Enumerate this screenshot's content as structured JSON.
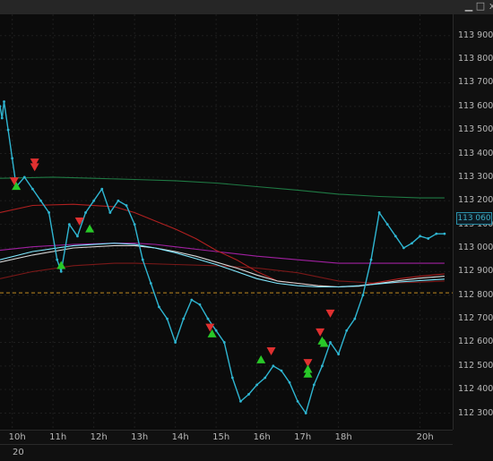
{
  "window": {
    "minimize_label": "▁",
    "restore_label": "□",
    "close_label": "x"
  },
  "current_price_label": "113 060",
  "date_label": "20",
  "colors": {
    "price": "#2fb6d2",
    "ema_cyan": "#7fe8ff",
    "ema_white": "#d8d8d8",
    "ma_green": "#1f7a44",
    "ma_red": "#b02020",
    "ma_darkred": "#7a1818",
    "ma_purple": "#a020a0",
    "level_line": "#c08a20",
    "buy_arrow": "#28c828",
    "sell_arrow": "#e03030"
  },
  "chart_data": {
    "type": "line",
    "title": "",
    "xlabel": "",
    "ylabel": "",
    "ylim": [
      112230,
      113990
    ],
    "y_ticks": [
      "113 900",
      "113 800",
      "113 700",
      "113 600",
      "113 500",
      "113 400",
      "113 300",
      "113 200",
      "113 100",
      "113 000",
      "112 900",
      "112 800",
      "112 700",
      "112 600",
      "112 500",
      "112 400",
      "112 300"
    ],
    "x_ticks": [
      "10h",
      "11h",
      "12h",
      "13h",
      "14h",
      "15h",
      "16h",
      "17h",
      "18h",
      "20h"
    ],
    "x_range": [
      9.7,
      20.8
    ],
    "horizontal_level": 112810,
    "series": [
      {
        "key": "price",
        "x": [
          9.7,
          9.75,
          9.8,
          9.9,
          10.0,
          10.1,
          10.3,
          10.5,
          10.7,
          10.9,
          11.1,
          11.2,
          11.4,
          11.6,
          11.8,
          12.0,
          12.2,
          12.4,
          12.6,
          12.8,
          13.0,
          13.2,
          13.4,
          13.6,
          13.8,
          14.0,
          14.2,
          14.4,
          14.6,
          14.8,
          15.0,
          15.2,
          15.4,
          15.6,
          15.8,
          16.0,
          16.2,
          16.4,
          16.6,
          16.8,
          17.0,
          17.2,
          17.4,
          17.6,
          17.8,
          18.0,
          18.2,
          18.4,
          18.6,
          18.8,
          19.0,
          19.2,
          19.4,
          19.6,
          19.8,
          20.0,
          20.2,
          20.4,
          20.6
        ],
        "y": [
          113600,
          113550,
          113620,
          113500,
          113380,
          113260,
          113300,
          113250,
          113200,
          113150,
          112950,
          112900,
          113100,
          113050,
          113150,
          113200,
          113250,
          113150,
          113200,
          113180,
          113100,
          112950,
          112850,
          112750,
          112700,
          112600,
          112700,
          112780,
          112760,
          112700,
          112650,
          112600,
          112450,
          112350,
          112380,
          112420,
          112450,
          112500,
          112480,
          112430,
          112350,
          112300,
          112420,
          112500,
          112600,
          112550,
          112650,
          112700,
          112800,
          112950,
          113150,
          113100,
          113050,
          113000,
          113020,
          113050,
          113040,
          113060,
          113060
        ]
      },
      {
        "key": "ma_green",
        "x": [
          9.7,
          11,
          12,
          13,
          14,
          15,
          16,
          17,
          18,
          19,
          20,
          20.6
        ],
        "y": [
          113295,
          113300,
          113295,
          113290,
          113285,
          113275,
          113260,
          113245,
          113228,
          113218,
          113212,
          113212
        ]
      },
      {
        "key": "ma_red",
        "x": [
          9.7,
          10.5,
          11.5,
          12.5,
          13.0,
          13.5,
          14,
          14.5,
          15,
          15.5,
          16,
          16.5,
          17,
          17.5,
          18,
          18.5,
          19,
          19.5,
          20,
          20.6
        ],
        "y": [
          113150,
          113180,
          113185,
          113175,
          113150,
          113115,
          113080,
          113040,
          112990,
          112950,
          112900,
          112860,
          112850,
          112840,
          112835,
          112840,
          112855,
          112870,
          112880,
          112890
        ]
      },
      {
        "key": "ma_purple",
        "x": [
          9.7,
          10.5,
          11.5,
          12.5,
          13,
          13.5,
          14,
          15,
          16,
          17,
          18,
          19,
          20,
          20.6
        ],
        "y": [
          112990,
          113005,
          113015,
          113020,
          113020,
          113015,
          113005,
          112985,
          112965,
          112950,
          112935,
          112935,
          112935,
          112935
        ]
      },
      {
        "key": "ma_darkred",
        "x": [
          9.7,
          10.5,
          11.5,
          12.5,
          13,
          14,
          15,
          16,
          17,
          18,
          19,
          20,
          20.6
        ],
        "y": [
          112870,
          112900,
          112925,
          112935,
          112935,
          112930,
          112925,
          112915,
          112895,
          112860,
          112850,
          112855,
          112860
        ]
      },
      {
        "key": "ema_white",
        "x": [
          9.7,
          10.5,
          11.5,
          12.5,
          13,
          13.5,
          14,
          14.5,
          15,
          15.5,
          16,
          16.5,
          17,
          17.5,
          18,
          18.5,
          19,
          19.5,
          20,
          20.6
        ],
        "y": [
          112940,
          112970,
          113000,
          113010,
          113010,
          113000,
          112985,
          112965,
          112940,
          112915,
          112885,
          112860,
          112850,
          112840,
          112835,
          112838,
          112850,
          112862,
          112872,
          112880
        ]
      },
      {
        "key": "ema_cyan",
        "x": [
          9.7,
          10.5,
          11.5,
          12.5,
          13,
          13.5,
          14,
          14.5,
          15,
          15.5,
          16,
          16.5,
          17,
          17.5,
          18,
          18.5,
          19,
          19.5,
          20,
          20.6
        ],
        "y": [
          112950,
          112985,
          113010,
          113020,
          113015,
          113000,
          112980,
          112955,
          112930,
          112900,
          112870,
          112850,
          112840,
          112835,
          112835,
          112840,
          112848,
          112856,
          112862,
          112868
        ]
      }
    ],
    "signals": [
      {
        "x": 10.05,
        "y": 113280,
        "kind": "sell"
      },
      {
        "x": 10.1,
        "y": 113265,
        "kind": "buy"
      },
      {
        "x": 10.55,
        "y": 113360,
        "kind": "sell"
      },
      {
        "x": 10.55,
        "y": 113340,
        "kind": "sell"
      },
      {
        "x": 11.2,
        "y": 112930,
        "kind": "buy"
      },
      {
        "x": 11.65,
        "y": 113110,
        "kind": "sell"
      },
      {
        "x": 11.9,
        "y": 113085,
        "kind": "buy"
      },
      {
        "x": 14.85,
        "y": 112660,
        "kind": "sell"
      },
      {
        "x": 14.9,
        "y": 112640,
        "kind": "buy"
      },
      {
        "x": 16.1,
        "y": 112530,
        "kind": "buy"
      },
      {
        "x": 16.35,
        "y": 112560,
        "kind": "sell"
      },
      {
        "x": 17.25,
        "y": 112510,
        "kind": "sell"
      },
      {
        "x": 17.25,
        "y": 112490,
        "kind": "buy"
      },
      {
        "x": 17.25,
        "y": 112470,
        "kind": "buy"
      },
      {
        "x": 17.55,
        "y": 112640,
        "kind": "sell"
      },
      {
        "x": 17.6,
        "y": 112610,
        "kind": "buy"
      },
      {
        "x": 17.65,
        "y": 112600,
        "kind": "buy"
      },
      {
        "x": 17.8,
        "y": 112720,
        "kind": "sell"
      }
    ]
  }
}
